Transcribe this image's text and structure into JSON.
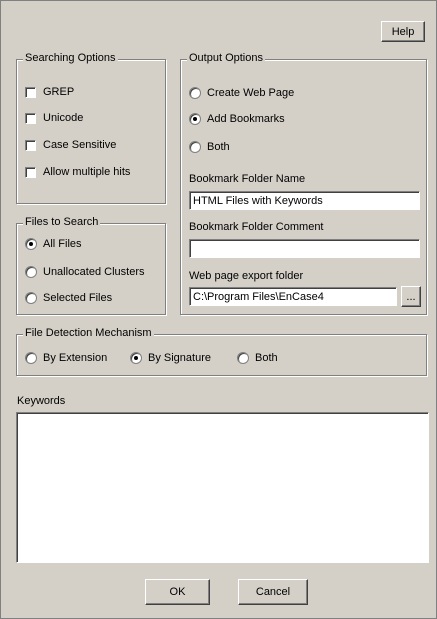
{
  "help_label": "Help",
  "searching": {
    "legend": "Searching Options",
    "items": [
      "GREP",
      "Unicode",
      "Case Sensitive",
      "Allow multiple hits"
    ]
  },
  "files": {
    "legend": "Files to Search",
    "items": [
      "All Files",
      "Unallocated Clusters",
      "Selected Files"
    ],
    "selected": "All Files"
  },
  "output": {
    "legend": "Output Options",
    "items": [
      "Create Web Page",
      "Add Bookmarks",
      "Both"
    ],
    "selected": "Add Bookmarks",
    "folder_name_label": "Bookmark Folder Name",
    "folder_name_value": "HTML Files with Keywords",
    "folder_comment_label": "Bookmark Folder Comment",
    "folder_comment_value": "",
    "export_label": "Web page export folder",
    "export_value": "C:\\Program Files\\EnCase4",
    "browse_label": "..."
  },
  "detection": {
    "legend": "File Detection Mechanism",
    "items": [
      "By Extension",
      "By Signature",
      "Both"
    ],
    "selected": "By Signature"
  },
  "keywords": {
    "label": "Keywords",
    "value": ""
  },
  "ok_label": "OK",
  "cancel_label": "Cancel"
}
